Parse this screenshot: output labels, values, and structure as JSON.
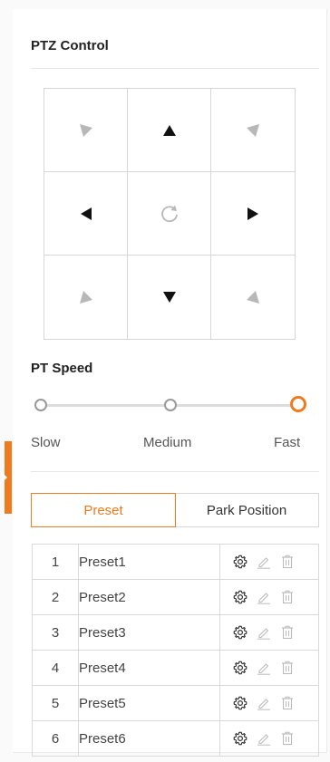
{
  "header": {
    "title": "PTZ Control"
  },
  "dpad": {
    "cells": [
      {
        "dir": "up-left",
        "icon": "arrow-up-left-icon",
        "active": false
      },
      {
        "dir": "up",
        "icon": "arrow-up-icon",
        "active": true
      },
      {
        "dir": "up-right",
        "icon": "arrow-up-right-icon",
        "active": false
      },
      {
        "dir": "left",
        "icon": "arrow-left-icon",
        "active": true
      },
      {
        "dir": "reset",
        "icon": "reset-icon",
        "active": false
      },
      {
        "dir": "right",
        "icon": "arrow-right-icon",
        "active": true
      },
      {
        "dir": "down-left",
        "icon": "arrow-down-left-icon",
        "active": false
      },
      {
        "dir": "down",
        "icon": "arrow-down-icon",
        "active": true
      },
      {
        "dir": "down-right",
        "icon": "arrow-down-right-icon",
        "active": false
      }
    ]
  },
  "speed": {
    "label": "PT Speed",
    "options": [
      "Slow",
      "Medium",
      "Fast"
    ],
    "selected": "Fast"
  },
  "tabs": [
    {
      "label": "Preset",
      "active": true
    },
    {
      "label": "Park Position",
      "active": false
    }
  ],
  "presets": [
    {
      "num": "1",
      "name": "Preset1"
    },
    {
      "num": "2",
      "name": "Preset2"
    },
    {
      "num": "3",
      "name": "Preset3"
    },
    {
      "num": "4",
      "name": "Preset4"
    },
    {
      "num": "5",
      "name": "Preset5"
    },
    {
      "num": "6",
      "name": "Preset6"
    }
  ],
  "colors": {
    "accent": "#f07a1e",
    "active_arrow": "#111111",
    "inactive_arrow": "#b8b8b8"
  }
}
